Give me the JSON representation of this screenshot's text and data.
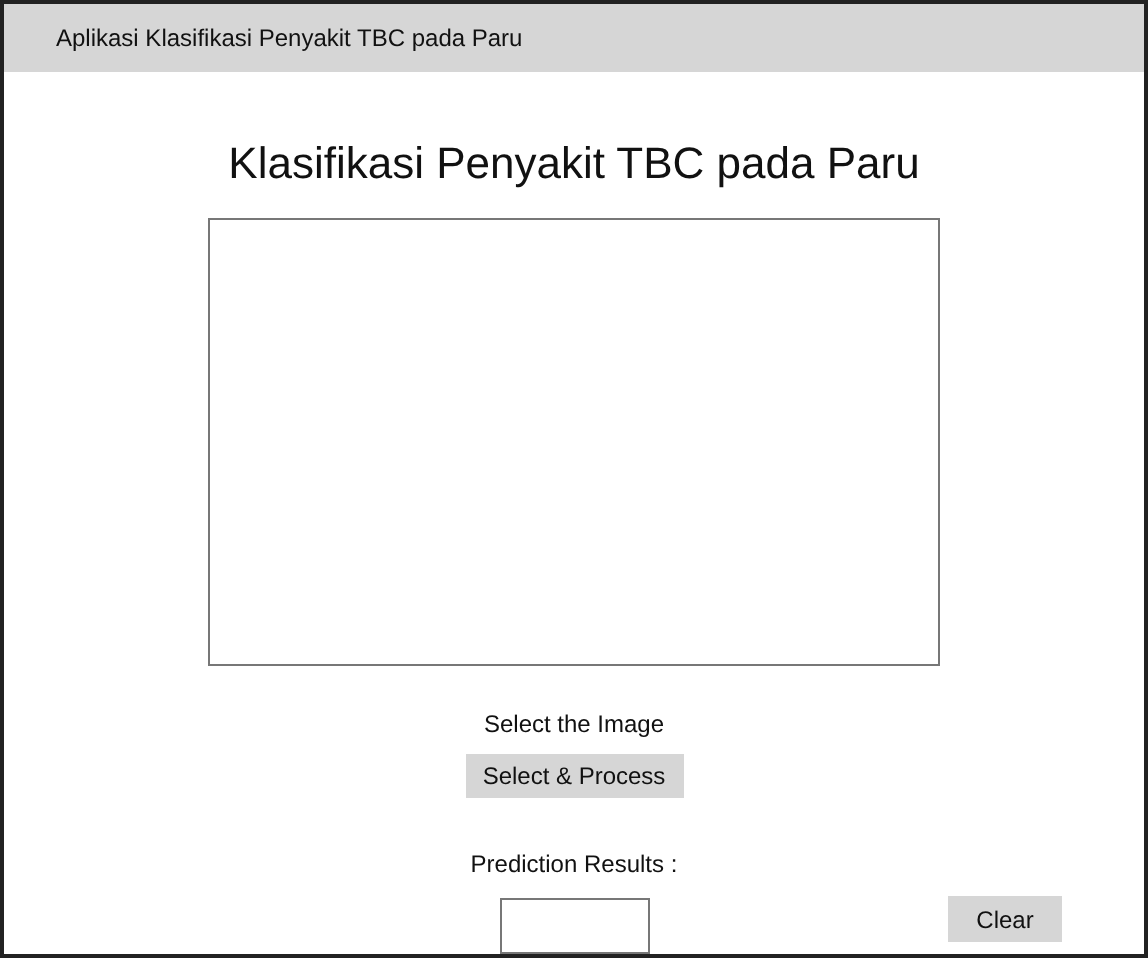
{
  "window": {
    "title": "Aplikasi Klasifikasi Penyakit TBC pada Paru"
  },
  "heading": "Klasifikasi Penyakit TBC pada Paru",
  "image_area": {
    "kind": "empty"
  },
  "select_label": "Select the Image",
  "select_button": "Select & Process",
  "prediction": {
    "label": "Prediction Results :"
  },
  "clear_button": "Clear"
}
